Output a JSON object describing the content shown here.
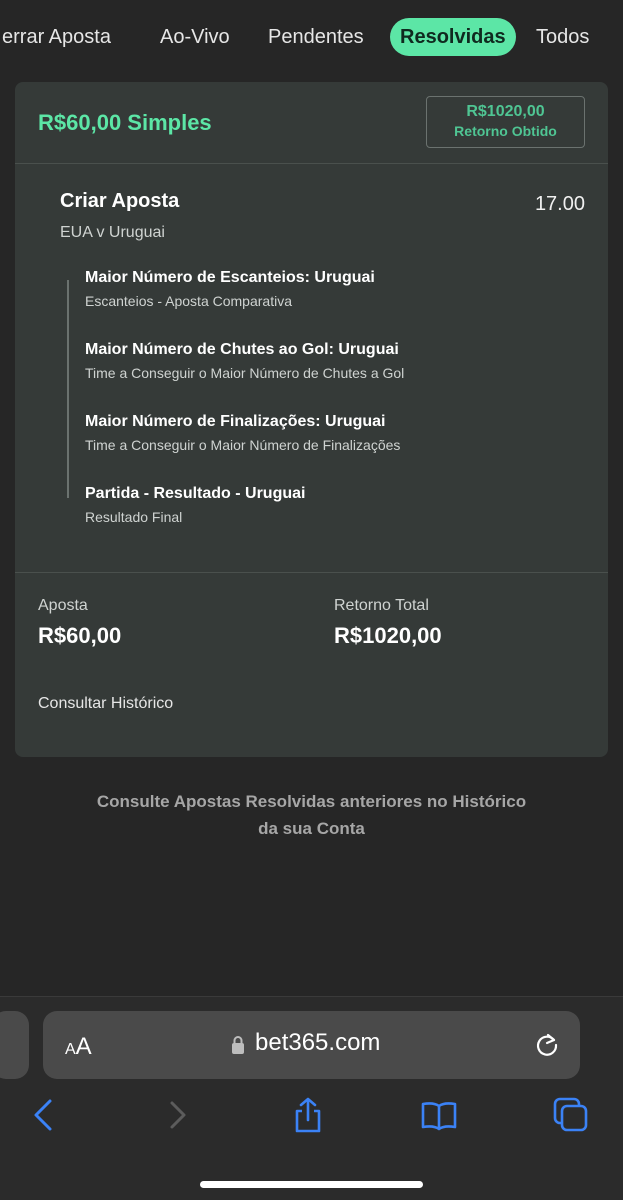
{
  "tabs": {
    "cerrar": "errar Aposta",
    "aovivo": "Ao-Vivo",
    "pendentes": "Pendentes",
    "resolvidas": "Resolvidas",
    "todos": "Todos"
  },
  "bet": {
    "stake_title": "R$60,00 Simples",
    "return_amount": "R$1020,00",
    "return_label": "Retorno Obtido",
    "title": "Criar Aposta",
    "odds": "17.00",
    "match": "EUA v Uruguai",
    "selections": [
      {
        "name": "Maior Número de Escanteios: Uruguai",
        "desc": "Escanteios - Aposta Comparativa"
      },
      {
        "name": "Maior Número de Chutes ao Gol: Uruguai",
        "desc": "Time a Conseguir o Maior Número de Chutes a Gol"
      },
      {
        "name": "Maior Número de Finalizações: Uruguai",
        "desc": "Time a Conseguir o Maior Número de Finalizações"
      },
      {
        "name": "Partida - Resultado - Uruguai",
        "desc": "Resultado Final"
      }
    ],
    "stake_label": "Aposta",
    "stake_value": "R$60,00",
    "total_label": "Retorno Total",
    "total_value": "R$1020,00",
    "history_link": "Consultar Histórico"
  },
  "info": {
    "line1": "Consulte Apostas Resolvidas anteriores no Histórico",
    "line2": "da sua Conta"
  },
  "browser": {
    "aa_small": "A",
    "aa_large": "A",
    "url": "bet365.com"
  },
  "colors": {
    "accent": "#5ce6a6",
    "background": "#262626",
    "card": "#353a38"
  }
}
